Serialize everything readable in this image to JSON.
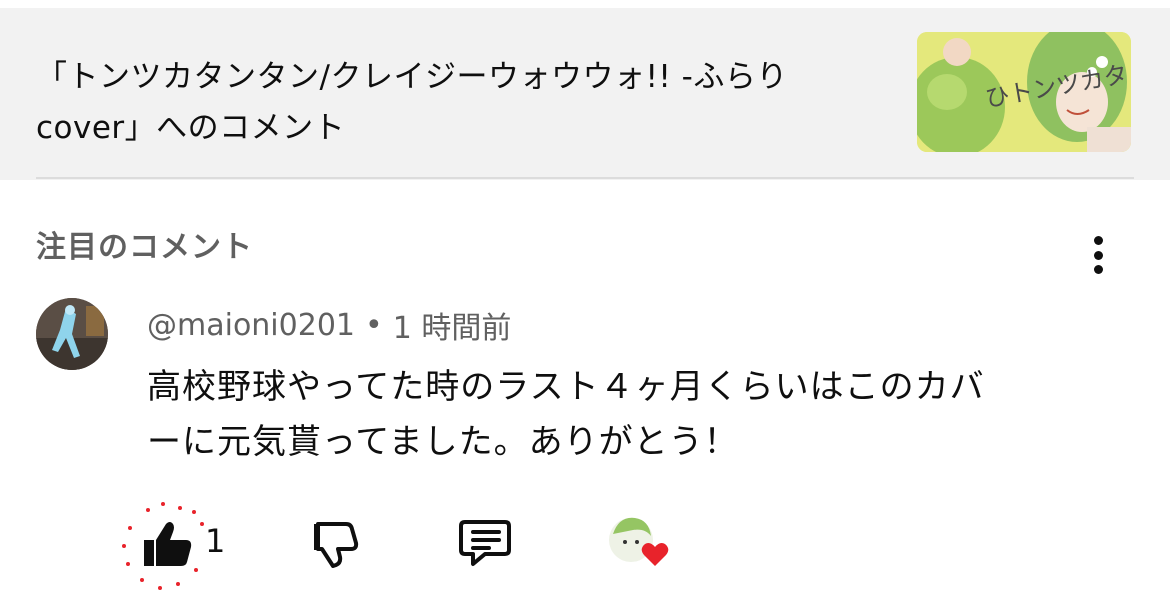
{
  "header": {
    "video_title_line1": "「トンツカタンタン/クレイジーウォウウォ!! -ふらり",
    "video_title_line2": "cover」へのコメント",
    "thumbnail_text": "ひトンツカタ"
  },
  "section": {
    "title": "注目のコメント"
  },
  "comment": {
    "author": "@maioni0201",
    "separator": "•",
    "time": "1 時間前",
    "text_line1": "高校野球やってた時のラスト４ヶ月くらいはこのカバ",
    "text_line2": "ーに元気貰ってました。ありがとう！",
    "like_count": "1",
    "liked": true
  },
  "icons": {
    "menu": "more-vert-icon",
    "like": "thumb-up-filled-icon",
    "dislike": "thumb-down-icon",
    "reply": "comment-reply-icon",
    "heart": "creator-heart-icon"
  },
  "colors": {
    "header_bg": "#f2f2f2",
    "secondary_text": "#606060",
    "heart": "#e8232b",
    "like_sparkle": "#e8232b"
  }
}
